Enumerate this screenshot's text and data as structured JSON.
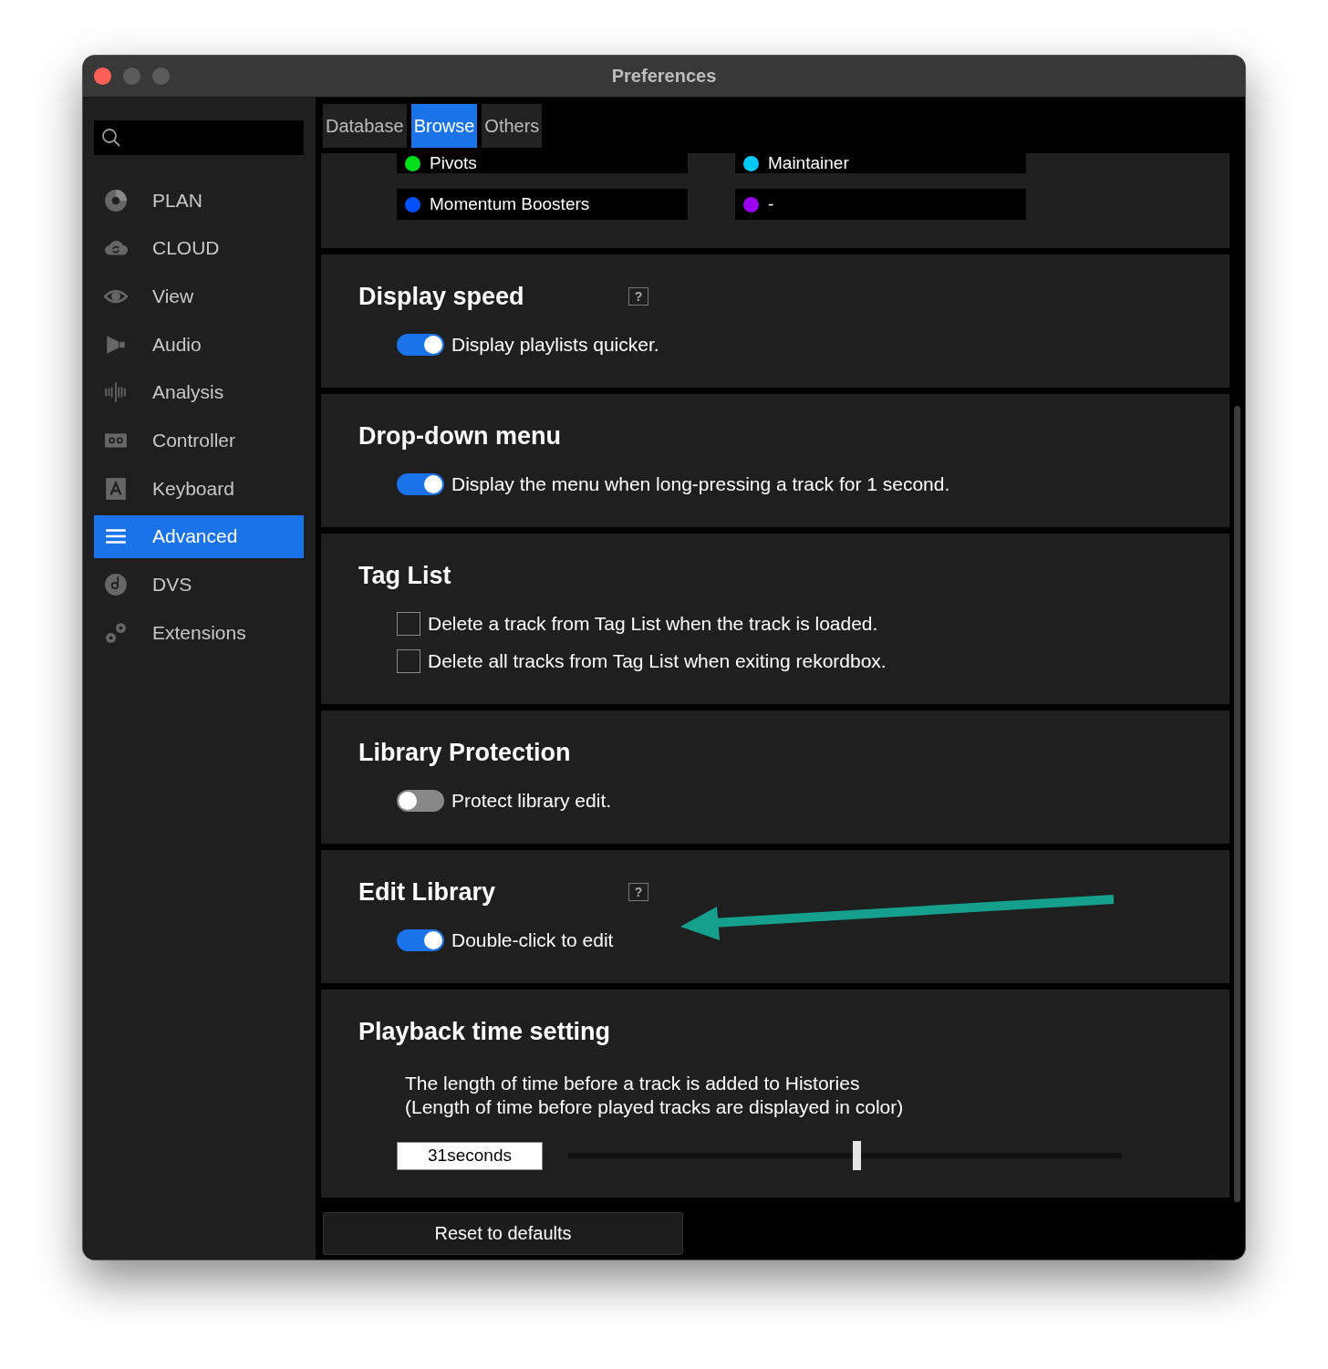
{
  "window": {
    "title": "Preferences"
  },
  "sidebar": {
    "items": [
      {
        "label": "PLAN",
        "selected": false
      },
      {
        "label": "CLOUD",
        "selected": false
      },
      {
        "label": "View",
        "selected": false
      },
      {
        "label": "Audio",
        "selected": false
      },
      {
        "label": "Analysis",
        "selected": false
      },
      {
        "label": "Controller",
        "selected": false
      },
      {
        "label": "Keyboard",
        "selected": false
      },
      {
        "label": "Advanced",
        "selected": true
      },
      {
        "label": "DVS",
        "selected": false
      },
      {
        "label": "Extensions",
        "selected": false
      }
    ]
  },
  "tabs": [
    {
      "label": "Database",
      "selected": false
    },
    {
      "label": "Browse",
      "selected": true
    },
    {
      "label": "Others",
      "selected": false
    }
  ],
  "sections": [
    {
      "kind": "tags",
      "tags": [
        {
          "label": "Pivots",
          "color": "#00e01a"
        },
        {
          "label": "Maintainer",
          "color": "#00c8f5"
        },
        {
          "label": "Momentum Boosters",
          "color": "#0050ff"
        },
        {
          "label": "-",
          "color": "#9b00f0"
        }
      ]
    },
    {
      "kind": "toggles",
      "title": "Display speed",
      "help": "?",
      "options": [
        {
          "label": "Display playlists quicker.",
          "on": true
        }
      ]
    },
    {
      "kind": "toggles",
      "title": "Drop-down menu",
      "options": [
        {
          "label": "Display the menu when long-pressing a track for 1 second.",
          "on": true
        }
      ]
    },
    {
      "kind": "checkboxes",
      "title": "Tag List",
      "options": [
        {
          "label": "Delete a track from Tag List when the track is loaded.",
          "checked": false
        },
        {
          "label": "Delete all tracks from Tag List when exiting rekordbox.",
          "checked": false
        }
      ]
    },
    {
      "kind": "toggles",
      "title": "Library Protection",
      "options": [
        {
          "label": "Protect library edit.",
          "on": false
        }
      ]
    },
    {
      "kind": "toggles",
      "title": "Edit Library",
      "help": "?",
      "options": [
        {
          "label": "Double-click to edit",
          "on": true
        }
      ]
    },
    {
      "kind": "time",
      "title": "Playback time setting",
      "description": [
        "The length of time before a track is added to Histories",
        "(Length of time before played tracks are displayed in color)"
      ],
      "value": "31seconds",
      "level": 0.52
    }
  ],
  "reset_button": "Reset to defaults"
}
